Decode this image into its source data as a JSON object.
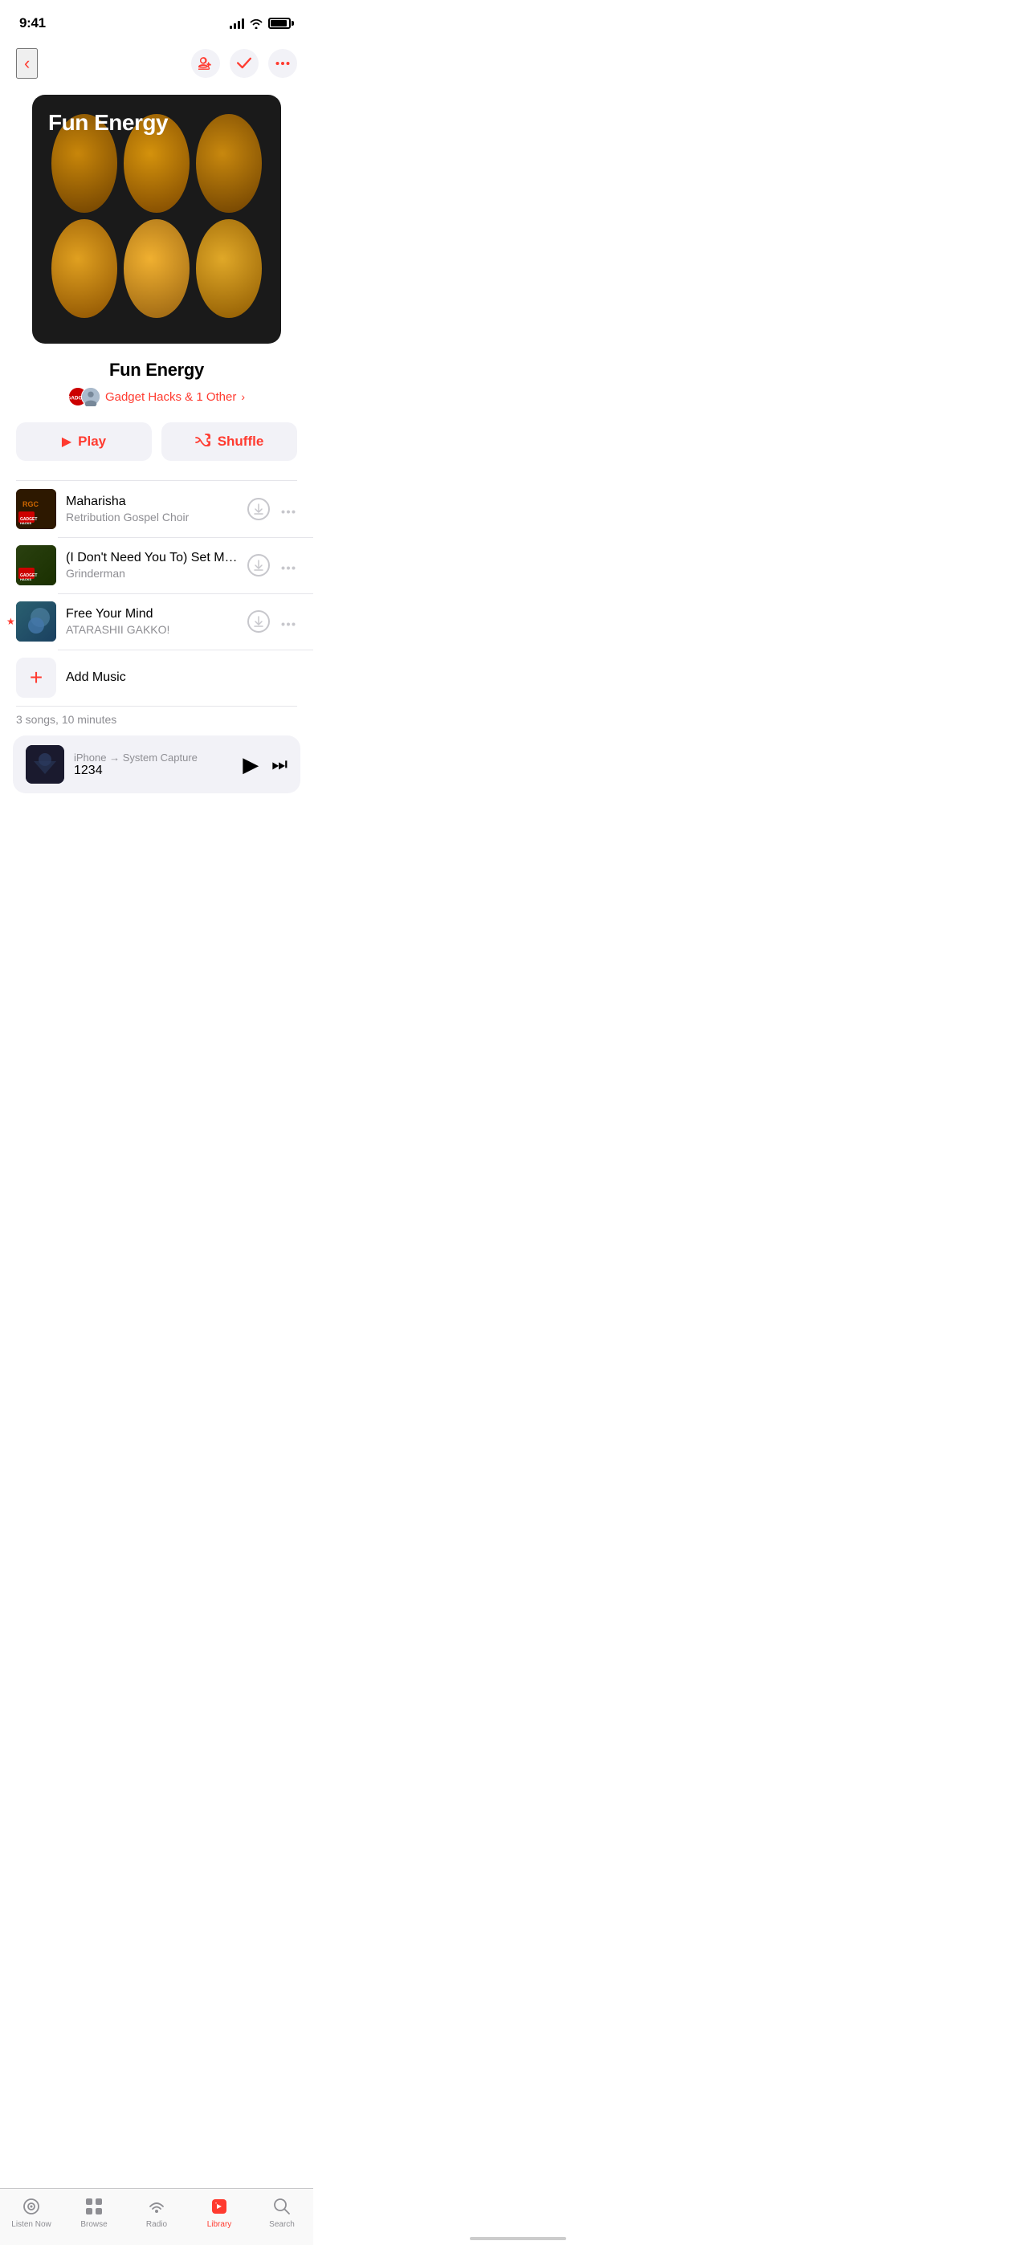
{
  "statusBar": {
    "time": "9:41"
  },
  "nav": {
    "backLabel": "‹",
    "addFriendsLabel": "Add Friends",
    "checkLabel": "✓",
    "moreLabel": "···"
  },
  "playlist": {
    "title": "Fun Energy",
    "albumArtTitle": "Fun Energy",
    "authors": "Gadget Hacks & 1 Other",
    "authorsChevron": "›"
  },
  "buttons": {
    "play": "Play",
    "shuffle": "Shuffle"
  },
  "songs": [
    {
      "id": 1,
      "title": "Maharisha",
      "artist": "Retribution Gospel Choir",
      "thumb": "rge"
    },
    {
      "id": 2,
      "title": "(I Don't Need You To) Set Me Free",
      "artist": "Grinderman",
      "thumb": "grinder"
    },
    {
      "id": 3,
      "title": "Free Your Mind",
      "artist": "ATARASHII GAKKO!",
      "thumb": "atarashii",
      "starred": true
    }
  ],
  "addMusic": {
    "label": "Add Music"
  },
  "songCount": "3 songs, 10 minutes",
  "miniPlayer": {
    "source": "iPhone → System Capture",
    "track": "1234"
  },
  "tabBar": {
    "tabs": [
      {
        "id": "listen-now",
        "label": "Listen Now",
        "active": false
      },
      {
        "id": "browse",
        "label": "Browse",
        "active": false
      },
      {
        "id": "radio",
        "label": "Radio",
        "active": false
      },
      {
        "id": "library",
        "label": "Library",
        "active": true
      },
      {
        "id": "search",
        "label": "Search",
        "active": false
      }
    ]
  }
}
